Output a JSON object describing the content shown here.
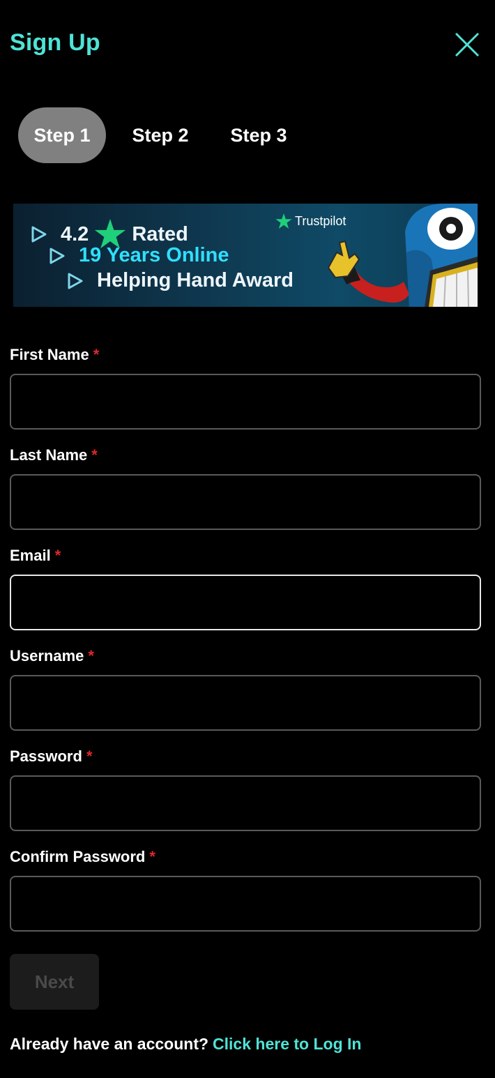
{
  "header": {
    "title": "Sign Up",
    "close_icon": "close-icon"
  },
  "steps": [
    {
      "label": "Step 1",
      "active": true
    },
    {
      "label": "Step 2",
      "active": false
    },
    {
      "label": "Step 3",
      "active": false
    }
  ],
  "banner": {
    "rating": "4.2",
    "rated_label": "Rated",
    "years_online": "19 Years Online",
    "award": "Helping Hand Award",
    "trustpilot": "Trustpilot"
  },
  "form": {
    "required_marker": "*",
    "fields": [
      {
        "label": "First Name",
        "value": ""
      },
      {
        "label": "Last Name",
        "value": ""
      },
      {
        "label": "Email",
        "value": "",
        "focused": true
      },
      {
        "label": "Username",
        "value": ""
      },
      {
        "label": "Password",
        "value": ""
      },
      {
        "label": "Confirm Password",
        "value": ""
      }
    ]
  },
  "actions": {
    "next_label": "Next",
    "login_prompt": "Already have an account?",
    "login_link": "Click here to Log In"
  },
  "colors": {
    "accent": "#4fe3d6",
    "required": "#e02828",
    "active_step_bg": "#808080"
  }
}
